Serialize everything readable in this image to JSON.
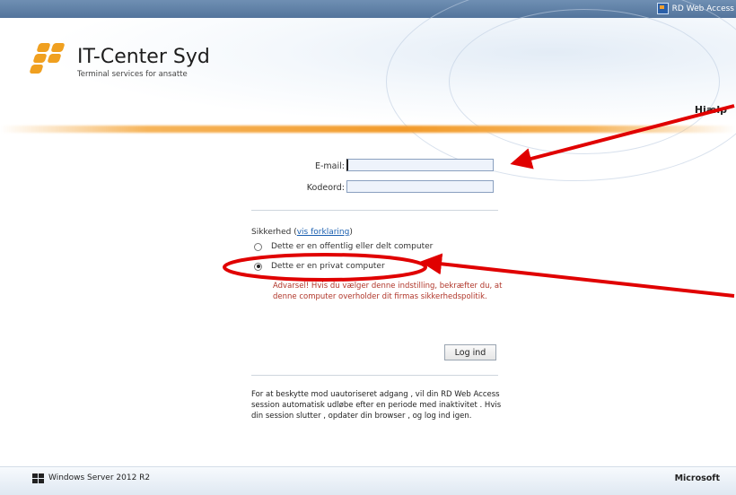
{
  "topbar": {
    "title": "RD Web Access",
    "icon": "rd-web-access-icon"
  },
  "brand": {
    "title": "IT-Center Syd",
    "subtitle": "Terminal services for ansatte",
    "logo_color": "#f0a020"
  },
  "header": {
    "help_label": "Hjælp"
  },
  "form": {
    "email_label": "E-mail:",
    "email_value": "",
    "password_label": "Kodeord:",
    "password_value": "",
    "security_label": "Sikkerhed (",
    "security_link": "vis forklaring",
    "security_label_end": ")",
    "radio_public": "Dette er en offentlig eller delt computer",
    "radio_private": "Dette er en privat computer",
    "selected": "private",
    "warning": "Advarsel! Hvis du vælger denne indstilling, bekræfter du, at denne computer overholder dit firmas sikkerhedspolitik.",
    "login_button": "Log ind",
    "info": "For at beskytte mod uautoriseret adgang , vil din RD Web Access session automatisk udløbe efter en periode med inaktivitet . Hvis din session slutter , opdater din browser , og log ind igen."
  },
  "footer": {
    "os": "Windows Server 2012 R2",
    "vendor": "Microsoft"
  },
  "annotations": {
    "color": "#e00000"
  }
}
